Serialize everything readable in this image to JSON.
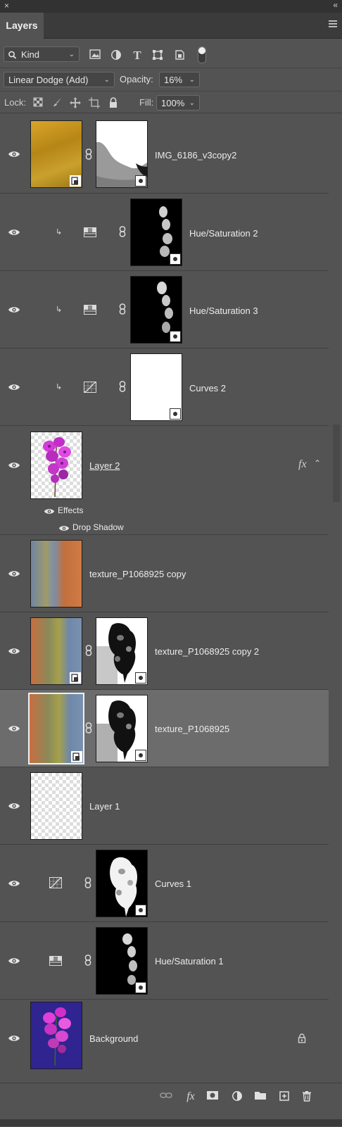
{
  "window": {
    "close_glyph": "×",
    "collapse_glyph": "«"
  },
  "panel": {
    "tab_label": "Layers",
    "menu_icon": "hamburger-menu-icon"
  },
  "filter": {
    "kind_label": "Kind",
    "kind_icon": "search-icon",
    "filter_icons": [
      "image-filter-icon",
      "adjustment-filter-icon",
      "type-filter-icon",
      "shape-filter-icon",
      "smart-object-filter-icon"
    ]
  },
  "blend": {
    "mode_value": "Linear Dodge (Add)",
    "opacity_label": "Opacity:",
    "opacity_value": "16%"
  },
  "lock": {
    "label": "Lock:",
    "fill_label": "Fill:",
    "fill_value": "100%",
    "icons": [
      "lock-transparent-pixels-icon",
      "lock-image-pixels-icon",
      "lock-position-icon",
      "lock-artboard-icon",
      "lock-all-icon"
    ]
  },
  "layers": [
    {
      "name": "IMG_6186_v3copy2",
      "kind": "smart-object-with-mask"
    },
    {
      "name": "Hue/Saturation 2",
      "kind": "hue-sat-adjustment",
      "clipped": true
    },
    {
      "name": "Hue/Saturation 3",
      "kind": "hue-sat-adjustment",
      "clipped": true
    },
    {
      "name": "Curves 2",
      "kind": "curves-adjustment",
      "clipped": true
    },
    {
      "name": "Layer 2",
      "kind": "pixel",
      "fx_label": "fx",
      "effects_label": "Effects",
      "effect_item": "Drop Shadow"
    },
    {
      "name": "texture_P1068925 copy",
      "kind": "pixel"
    },
    {
      "name": "texture_P1068925 copy 2",
      "kind": "smart-object-with-mask"
    },
    {
      "name": "texture_P1068925",
      "kind": "smart-object-with-mask",
      "selected": true
    },
    {
      "name": "Layer 1",
      "kind": "pixel"
    },
    {
      "name": "Curves 1",
      "kind": "curves-adjustment"
    },
    {
      "name": "Hue/Saturation 1",
      "kind": "hue-sat-adjustment"
    },
    {
      "name": "Background",
      "kind": "background",
      "locked": true
    }
  ],
  "footer": {
    "icons": [
      "link-layers-icon",
      "add-layer-style-icon",
      "add-mask-icon",
      "new-fill-adjustment-icon",
      "new-group-icon",
      "new-layer-icon",
      "delete-layer-icon"
    ]
  }
}
